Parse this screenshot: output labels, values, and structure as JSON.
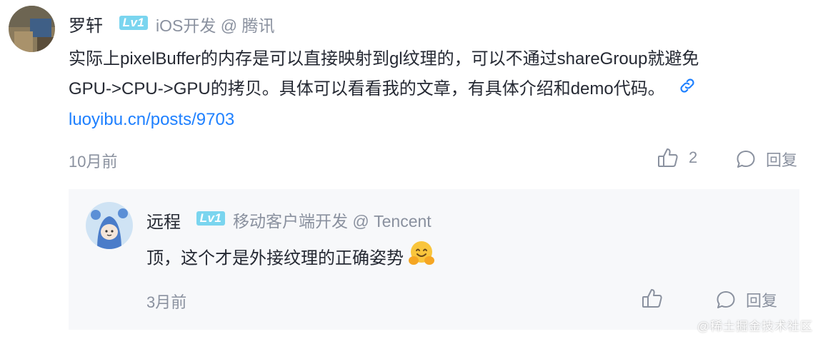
{
  "comment": {
    "author": "罗轩",
    "level": "Lv1",
    "job": "iOS开发 @ 腾讯",
    "content_lines": [
      "实际上pixelBuffer的内存是可以直接映射到gl纹理的，可以不通过shareGroup就避免",
      "GPU->CPU->GPU的拷贝。具体可以看看我的文章，有具体介绍和demo代码。"
    ],
    "link_url": "luoyibu.cn/posts/9703",
    "time": "10月前",
    "like_count": "2",
    "reply_label": "回复"
  },
  "reply": {
    "author": "远程",
    "level": "Lv1",
    "job": "移动客户端开发 @ Tencent",
    "content": "顶，这个才是外接纹理的正确姿势",
    "emoji": "hugging-face-emoji",
    "time": "3月前",
    "reply_label": "回复"
  },
  "watermark": "@稀土掘金技术社区",
  "colors": {
    "link": "#1e80ff",
    "level_badge": "#7ad5ef",
    "muted_text": "#8a919f",
    "main_text": "#252933",
    "reply_bg": "#f7f8fa"
  }
}
